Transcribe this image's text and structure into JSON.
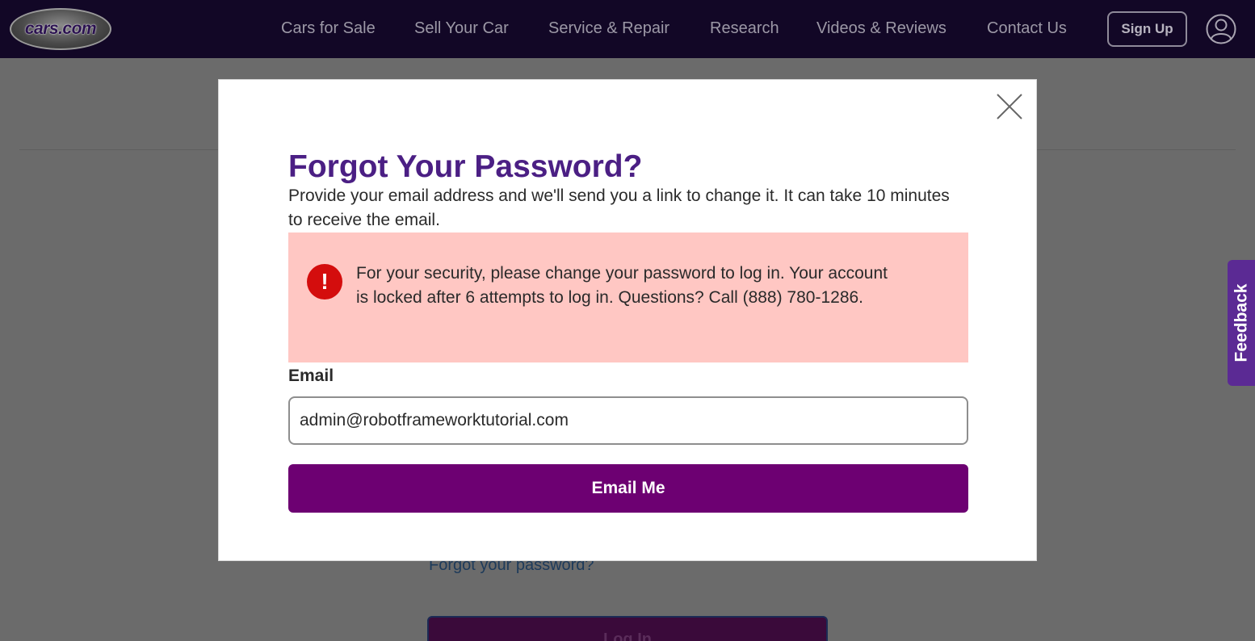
{
  "header": {
    "logo_text": "cars.com",
    "nav": [
      {
        "label": "Cars for Sale"
      },
      {
        "label": "Sell Your Car"
      },
      {
        "label": "Service & Repair"
      },
      {
        "label": "Research"
      },
      {
        "label": "Videos & Reviews"
      },
      {
        "label": "Contact Us"
      }
    ],
    "signup_label": "Sign Up"
  },
  "background": {
    "forgot_link": "Forgot your password?",
    "login_button": "Log In"
  },
  "feedback_label": "Feedback",
  "modal": {
    "title": "Forgot Your Password?",
    "description": "Provide your email address and we'll send you a link to change it. It can take 10 minutes to receive the email.",
    "alert": {
      "icon": "!",
      "message": "For your security, please change your password to log in. Your account is locked after 6 attempts to log in. Questions? Call (888) 780-1286."
    },
    "email_label": "Email",
    "email_value": "admin@robotframeworktutorial.com",
    "submit_label": "Email Me"
  },
  "colors": {
    "header_bg": "#120726",
    "title": "#4b1f84",
    "alert_bg": "#ffc7c3",
    "alert_icon": "#d40d0d",
    "primary_button": "#6d0072",
    "feedback_tab": "#5b2a94"
  }
}
